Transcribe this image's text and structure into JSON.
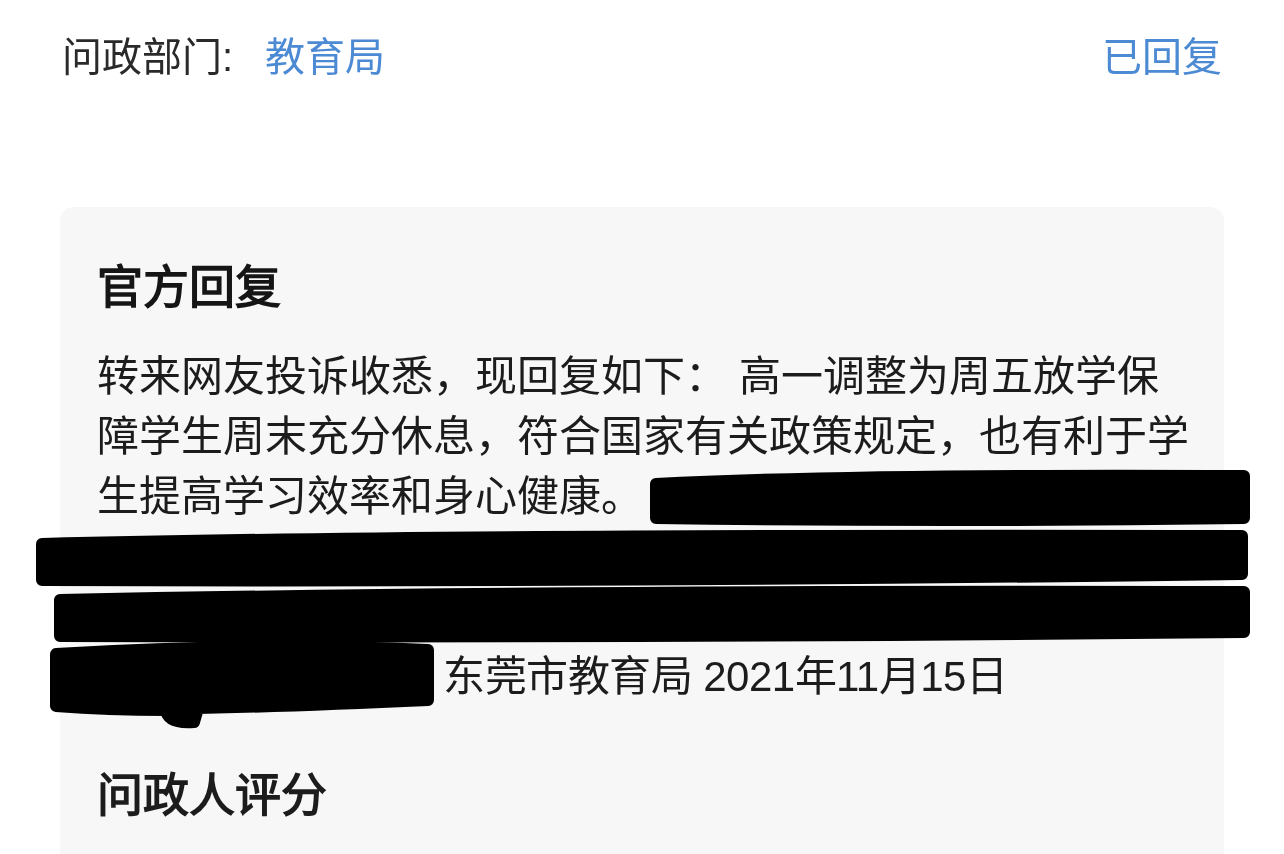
{
  "header": {
    "department_label": "问政部门:",
    "department": "教育局",
    "status": "已回复"
  },
  "official_reply": {
    "title": "官方回复",
    "text_lines": [
      "转来网友投诉收悉，现回复如下： 高一调整为周五放学保",
      "障学生周末充分休息，符合国家有关政策规定，也有利于学",
      "生提高学习效率和身心健康。"
    ],
    "signature": "东莞市教育局 2021年11月15日"
  },
  "rating": {
    "title": "问政人评分"
  }
}
